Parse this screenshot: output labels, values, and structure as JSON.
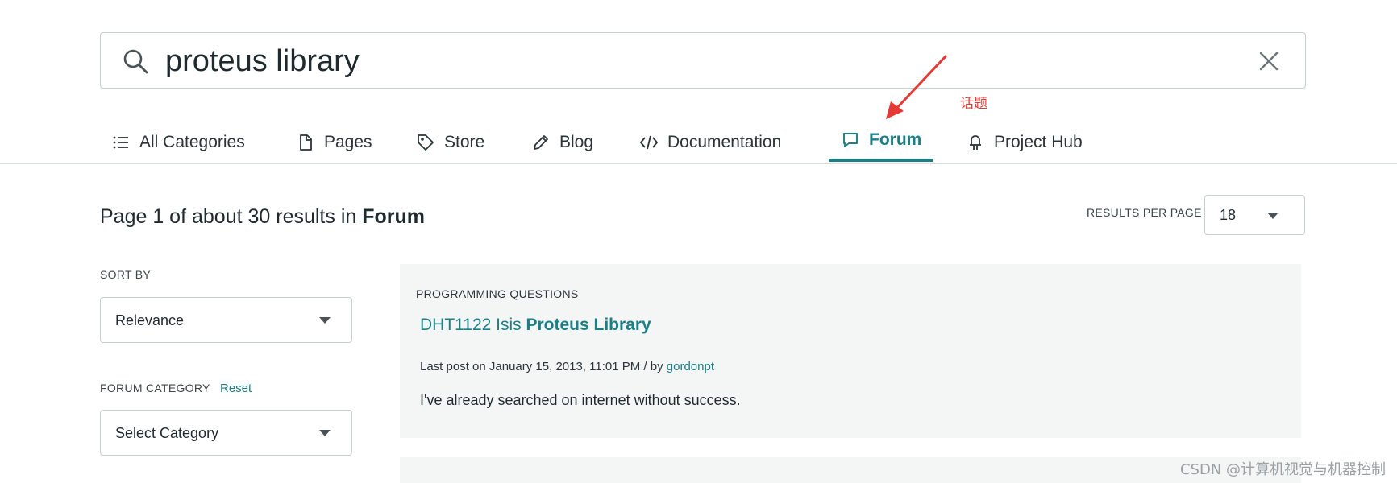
{
  "search": {
    "value": "proteus library",
    "placeholder": ""
  },
  "annotation": {
    "label": "话题",
    "color": "#e53935"
  },
  "tabs": [
    {
      "label": "All Categories",
      "icon": "list-icon"
    },
    {
      "label": "Pages",
      "icon": "page-icon"
    },
    {
      "label": "Store",
      "icon": "tag-icon"
    },
    {
      "label": "Blog",
      "icon": "pencil-icon"
    },
    {
      "label": "Documentation",
      "icon": "code-icon"
    },
    {
      "label": "Forum",
      "icon": "chat-bubble-icon",
      "active": true
    },
    {
      "label": "Project Hub",
      "icon": "project-hub-icon"
    }
  ],
  "results": {
    "summary_prefix": "Page 1 of about 30 results in",
    "summary_category": "Forum",
    "per_page_label": "RESULTS PER PAGE",
    "per_page_value": "18"
  },
  "sidebar": {
    "sort_label": "SORT BY",
    "sort_value": "Relevance",
    "category_label": "FORUM CATEGORY",
    "reset_label": "Reset",
    "category_value": "Select Category"
  },
  "items": [
    {
      "category": "PROGRAMMING QUESTIONS",
      "title_plain": "DHT1122 Isis",
      "title_bold": "Proteus Library",
      "meta_prefix": "Last post on January 15, 2013, 11:01 PM / by",
      "author": "gordonpt",
      "snippet": "I've already searched on internet without success."
    }
  ],
  "watermark": "CSDN @计算机视觉与机器控制",
  "colors": {
    "accent": "#1b7f86",
    "card_bg": "#f4f6f6",
    "text": "#1f2a2e"
  }
}
